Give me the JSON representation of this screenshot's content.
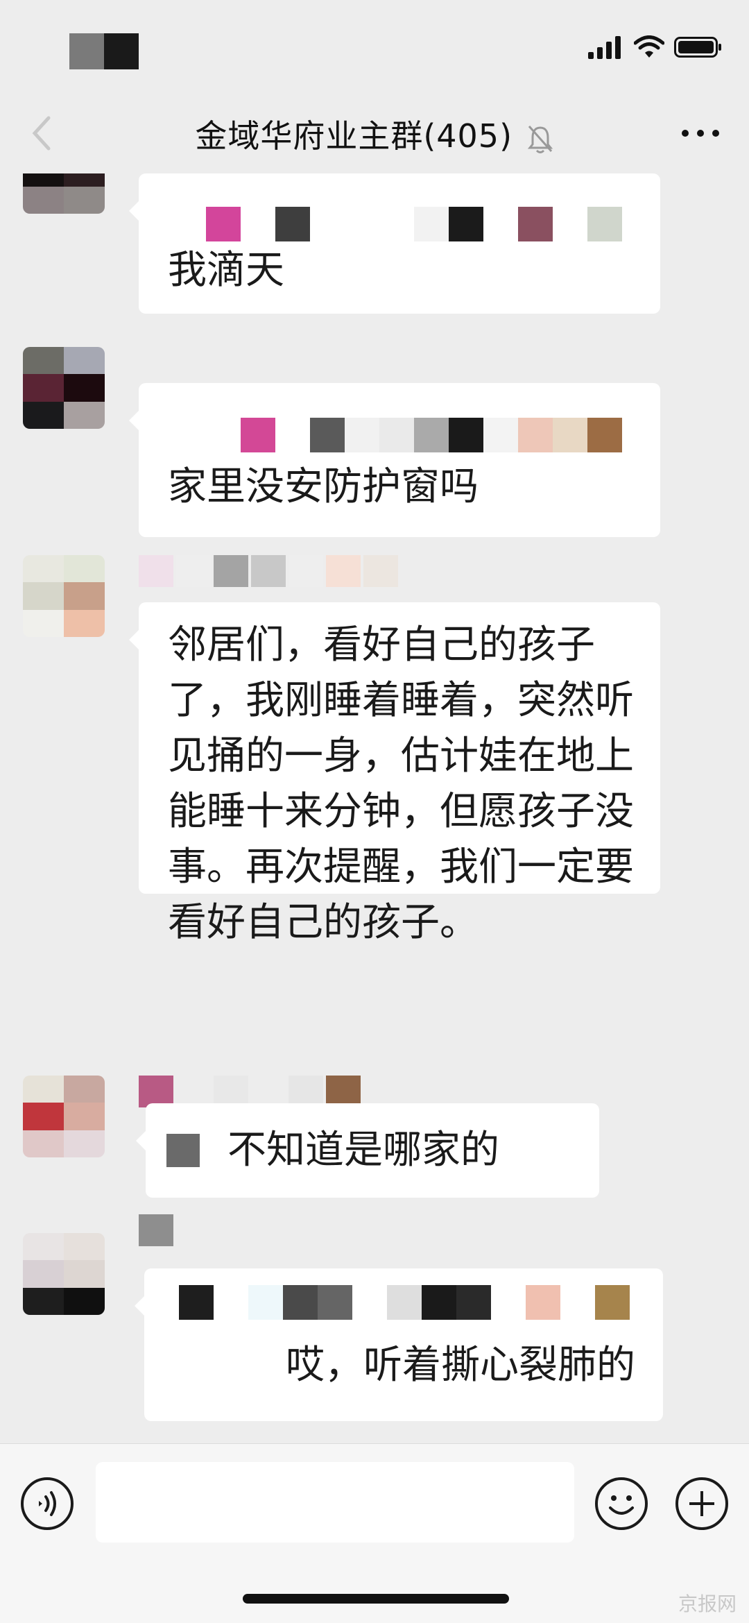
{
  "nav": {
    "title": "金域华府业主群(405)"
  },
  "icons": {
    "back": "chevron-left-icon",
    "mute": "bell-off-icon",
    "more": "more-dots-icon",
    "voice": "voice-icon",
    "emoji": "emoji-icon",
    "plus": "plus-icon"
  },
  "messages": [
    {
      "text": "我滴天"
    },
    {
      "text": "家里没安防护窗吗"
    },
    {
      "text": "邻居们，看好自己的孩子了，我刚睡着睡着，突然听见捅的一身，估计娃在地上能睡十来分钟，但愿孩子没事。再次提醒，我们一定要看好自己的孩子。"
    },
    {
      "text": "不知道是哪家的"
    },
    {
      "text": "哎，听着撕心裂肺的"
    }
  ],
  "input": {
    "placeholder": ""
  },
  "watermark": "京报网"
}
